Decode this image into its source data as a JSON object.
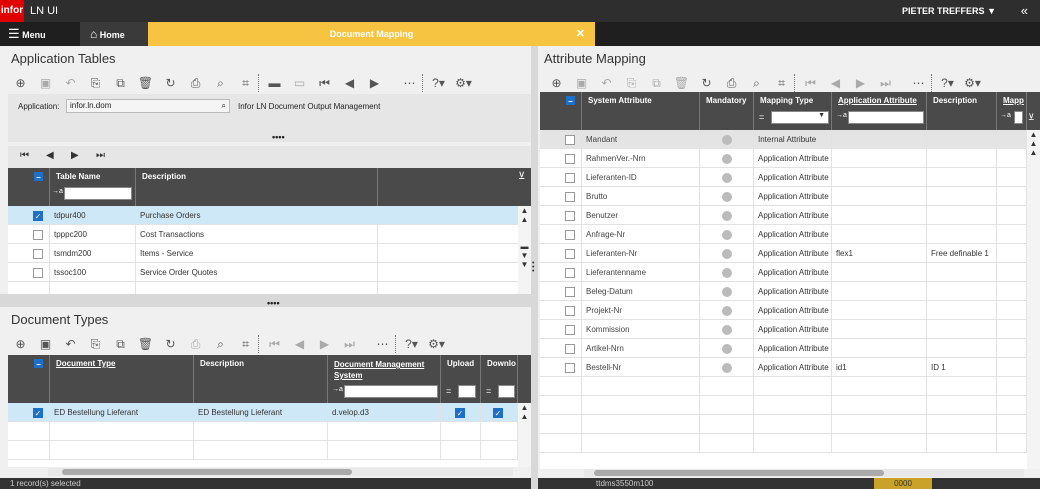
{
  "topbar": {
    "logo": "infor",
    "app_title": "LN UI",
    "user": "PIETER TREFFERS",
    "user_caret": "▼",
    "collapse": "«"
  },
  "tabs": {
    "menu": "Menu",
    "home": "Home",
    "active": "Document Mapping",
    "close": "✕"
  },
  "app_tables": {
    "title": "Application Tables",
    "application_label": "Application:",
    "application_value": "infor.ln.dom",
    "application_desc": "Infor LN Document Output Management",
    "columns": [
      "Table Name",
      "Description"
    ],
    "rows": [
      {
        "name": "tdpur400",
        "desc": "Purchase Orders",
        "checked": true
      },
      {
        "name": "tpppc200",
        "desc": "Cost Transactions",
        "checked": false
      },
      {
        "name": "tsmdm200",
        "desc": "Items - Service",
        "checked": false
      },
      {
        "name": "tssoc100",
        "desc": "Service Order Quotes",
        "checked": false
      }
    ]
  },
  "doc_types": {
    "title": "Document Types",
    "columns": [
      "Document Type",
      "Description",
      "Document Management System",
      "Upload",
      "Downlo"
    ],
    "rows": [
      {
        "type": "ED Bestellung Lieferant",
        "desc": "ED Bestellung Lieferant",
        "dms": "d.velop.d3",
        "upload": true,
        "download": true
      }
    ]
  },
  "attr_mapping": {
    "title": "Attribute Mapping",
    "columns": [
      "System Attribute",
      "Mandatory",
      "Mapping Type",
      "Application Attribute",
      "Description",
      "Mapp"
    ],
    "rows": [
      {
        "sys": "Mandant",
        "type": "Internal Attribute",
        "app": "",
        "desc": ""
      },
      {
        "sys": "RahmenVer.-Nrn",
        "type": "Application Attribute",
        "app": "",
        "desc": ""
      },
      {
        "sys": "Lieferanten-ID",
        "type": "Application Attribute",
        "app": "",
        "desc": ""
      },
      {
        "sys": "Brutto",
        "type": "Application Attribute",
        "app": "",
        "desc": ""
      },
      {
        "sys": "Benutzer",
        "type": "Application Attribute",
        "app": "",
        "desc": ""
      },
      {
        "sys": "Anfrage-Nr",
        "type": "Application Attribute",
        "app": "",
        "desc": ""
      },
      {
        "sys": "Lieferanten-Nr",
        "type": "Application Attribute",
        "app": "flex1",
        "desc": "Free definable 1"
      },
      {
        "sys": "Lieferantenname",
        "type": "Application Attribute",
        "app": "",
        "desc": ""
      },
      {
        "sys": "Beleg-Datum",
        "type": "Application Attribute",
        "app": "",
        "desc": ""
      },
      {
        "sys": "Projekt-Nr",
        "type": "Application Attribute",
        "app": "",
        "desc": ""
      },
      {
        "sys": "Kommission",
        "type": "Application Attribute",
        "app": "",
        "desc": ""
      },
      {
        "sys": "Artikel-Nrn",
        "type": "Application Attribute",
        "app": "",
        "desc": ""
      },
      {
        "sys": "Bestell-Nr",
        "type": "Application Attribute",
        "app": "id1",
        "desc": "ID 1"
      }
    ]
  },
  "status": {
    "left": "1 record(s) selected",
    "session": "ttdms3550m100",
    "code": "0000"
  },
  "filter_prefix": "→a",
  "eq": "="
}
